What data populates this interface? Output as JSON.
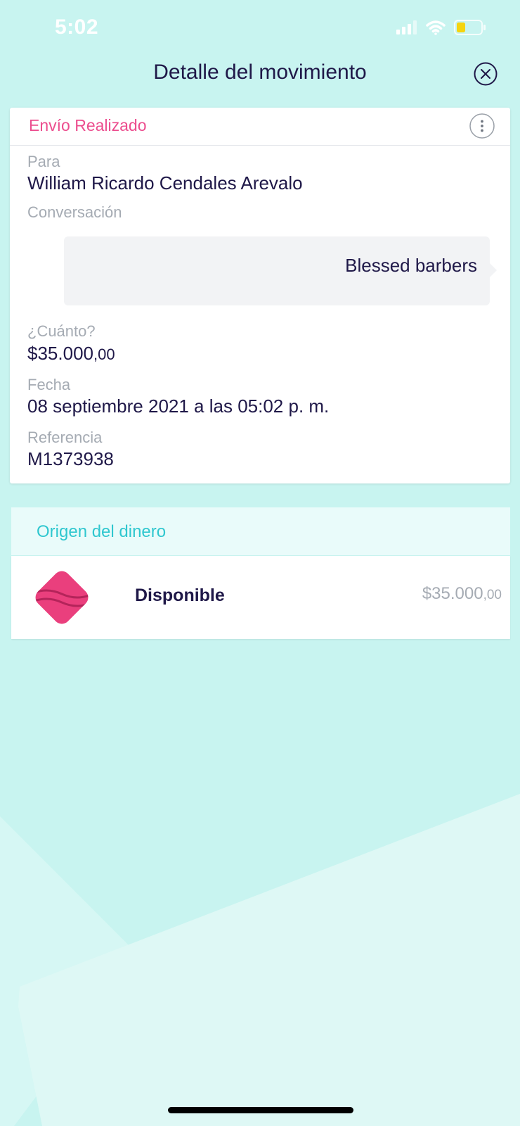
{
  "status_bar": {
    "time": "5:02"
  },
  "header": {
    "title": "Detalle del movimiento",
    "close_icon": "close-circle-icon"
  },
  "card": {
    "status": "Envío Realizado",
    "status_color": "#ec4d8e",
    "more_icon": "more-vertical-icon",
    "to": {
      "label": "Para",
      "value": "William Ricardo Cendales Arevalo"
    },
    "conversation": {
      "label": "Conversación",
      "message": "Blessed barbers"
    },
    "amount": {
      "label": "¿Cuánto?",
      "main": "$35.000",
      "cents": ",00"
    },
    "date": {
      "label": "Fecha",
      "value": "08 septiembre 2021 a las 05:02 p. m."
    },
    "reference": {
      "label": "Referencia",
      "value": "M1373938"
    }
  },
  "origin": {
    "title": "Origen del dinero",
    "title_color": "#2fc7cf",
    "source": {
      "icon": "nequi-diamond-icon",
      "name": "Disponible",
      "amount_main": "$35.000",
      "amount_cents": ",00"
    }
  },
  "colors": {
    "background": "#c8f4f0",
    "text_primary": "#1f1848",
    "text_secondary": "#a5abb3",
    "brand_pink": "#ec4d8e"
  }
}
